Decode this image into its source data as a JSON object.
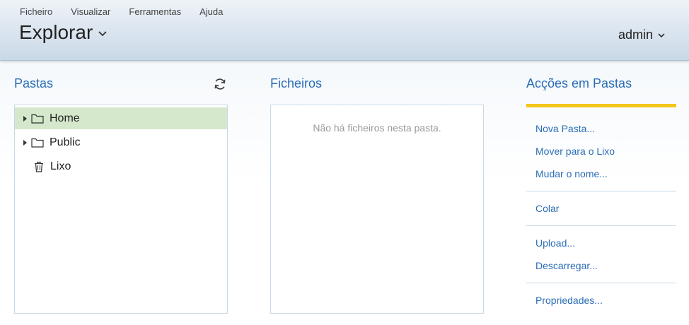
{
  "menu": [
    "Ficheiro",
    "Visualizar",
    "Ferramentas",
    "Ajuda"
  ],
  "app": {
    "title": "Explorar",
    "user": "admin"
  },
  "folders": {
    "title": "Pastas",
    "items": [
      {
        "label": "Home",
        "icon": "folder-icon",
        "selected": true
      },
      {
        "label": "Public",
        "icon": "folder-icon",
        "selected": false
      },
      {
        "label": "Lixo",
        "icon": "trash-icon",
        "selected": false
      }
    ]
  },
  "files": {
    "title": "Ficheiros",
    "empty_message": "Não há ficheiros nesta pasta."
  },
  "actions": {
    "title": "Acções em Pastas",
    "accent_color": "#f3c61a",
    "groups": [
      [
        "Nova Pasta...",
        "Mover para o Lixo",
        "Mudar o nome..."
      ],
      [
        "Colar"
      ],
      [
        "Upload...",
        "Descarregar..."
      ],
      [
        "Propriedades..."
      ]
    ]
  },
  "colors": {
    "link": "#2a6db5",
    "selected_row": "#d5e8cc"
  }
}
